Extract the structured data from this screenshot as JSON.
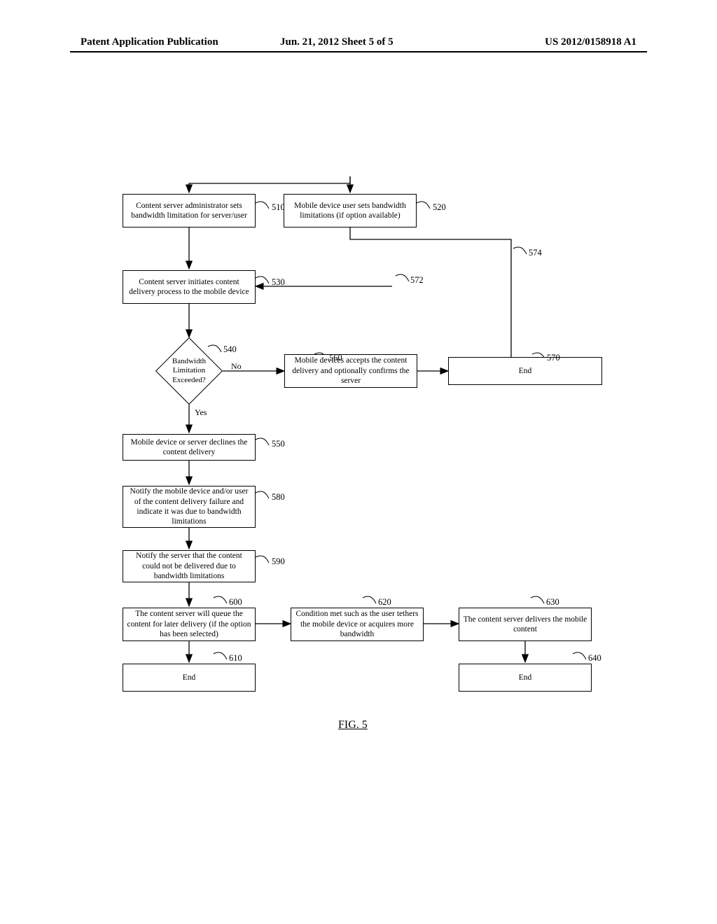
{
  "header": {
    "left": "Patent Application Publication",
    "center": "Jun. 21, 2012  Sheet 5 of 5",
    "right": "US 2012/0158918 A1"
  },
  "figure_label": "FIG.  5",
  "steps": {
    "s510": "Content server administrator sets bandwidth limitation for server/user",
    "s520": "Mobile device user sets bandwidth limitations (if option available)",
    "s530": "Content server initiates content delivery process to the mobile device",
    "s540": "Bandwidth Limitation Exceeded?",
    "s550": "Mobile device or server declines the content delivery",
    "s560": "Mobile devices accepts the content delivery and optionally confirms the server",
    "s570": "End",
    "s580": "Notify the mobile device and/or user of the content delivery failure and indicate it was due to bandwidth limitations",
    "s590": "Notify the server that the content could not be delivered due to bandwidth limitations",
    "s600": "The content server will queue the content for later delivery (if the option has been selected)",
    "s610": "End",
    "s620": "Condition met such as the user tethers the mobile device or acquires more bandwidth",
    "s630": "The content server delivers the mobile content",
    "s640": "End"
  },
  "labels": {
    "l510": "510",
    "l520": "520",
    "l530": "530",
    "l540": "540",
    "l550": "550",
    "l560": "560",
    "l570": "570",
    "l572": "572",
    "l574": "574",
    "l580": "580",
    "l590": "590",
    "l600": "600",
    "l610": "610",
    "l620": "620",
    "l630": "630",
    "l640": "640"
  },
  "branch": {
    "no": "No",
    "yes": "Yes"
  },
  "chart_data": {
    "type": "flowchart",
    "nodes": [
      {
        "id": "510",
        "label": "Content server administrator sets bandwidth limitation for server/user",
        "shape": "process"
      },
      {
        "id": "520",
        "label": "Mobile device user sets bandwidth limitations (if option available)",
        "shape": "process"
      },
      {
        "id": "530",
        "label": "Content server initiates content delivery process to the mobile device",
        "shape": "process"
      },
      {
        "id": "540",
        "label": "Bandwidth Limitation Exceeded?",
        "shape": "decision"
      },
      {
        "id": "550",
        "label": "Mobile device or server declines the content delivery",
        "shape": "process"
      },
      {
        "id": "560",
        "label": "Mobile devices accepts the content delivery and optionally confirms the server",
        "shape": "process"
      },
      {
        "id": "570",
        "label": "End",
        "shape": "terminator"
      },
      {
        "id": "580",
        "label": "Notify the mobile device and/or user of the content delivery failure and indicate it was due to bandwidth limitations",
        "shape": "process"
      },
      {
        "id": "590",
        "label": "Notify the server that the content could not be delivered due to bandwidth limitations",
        "shape": "process"
      },
      {
        "id": "600",
        "label": "The content server will queue the content for later delivery (if the option has been selected)",
        "shape": "process"
      },
      {
        "id": "610",
        "label": "End",
        "shape": "terminator"
      },
      {
        "id": "620",
        "label": "Condition met such as the user tethers the mobile device or acquires more bandwidth",
        "shape": "process"
      },
      {
        "id": "630",
        "label": "The content server delivers the mobile content",
        "shape": "process"
      },
      {
        "id": "640",
        "label": "End",
        "shape": "terminator"
      }
    ],
    "edges": [
      {
        "from": "start",
        "to": "510"
      },
      {
        "from": "start",
        "to": "520"
      },
      {
        "from": "510",
        "to": "530"
      },
      {
        "from": "520",
        "to": "574",
        "label": "574",
        "note": "to 570 region"
      },
      {
        "from": "530",
        "to": "540"
      },
      {
        "from": "540",
        "to": "560",
        "label": "No"
      },
      {
        "from": "540",
        "to": "550",
        "label": "Yes"
      },
      {
        "from": "560",
        "to": "570"
      },
      {
        "from": "550",
        "to": "580"
      },
      {
        "from": "580",
        "to": "590"
      },
      {
        "from": "590",
        "to": "600"
      },
      {
        "from": "600",
        "to": "610"
      },
      {
        "from": "600",
        "to": "620"
      },
      {
        "from": "620",
        "to": "630"
      },
      {
        "from": "630",
        "to": "640"
      },
      {
        "from": "572",
        "to": "530",
        "note": "feedback"
      }
    ]
  }
}
